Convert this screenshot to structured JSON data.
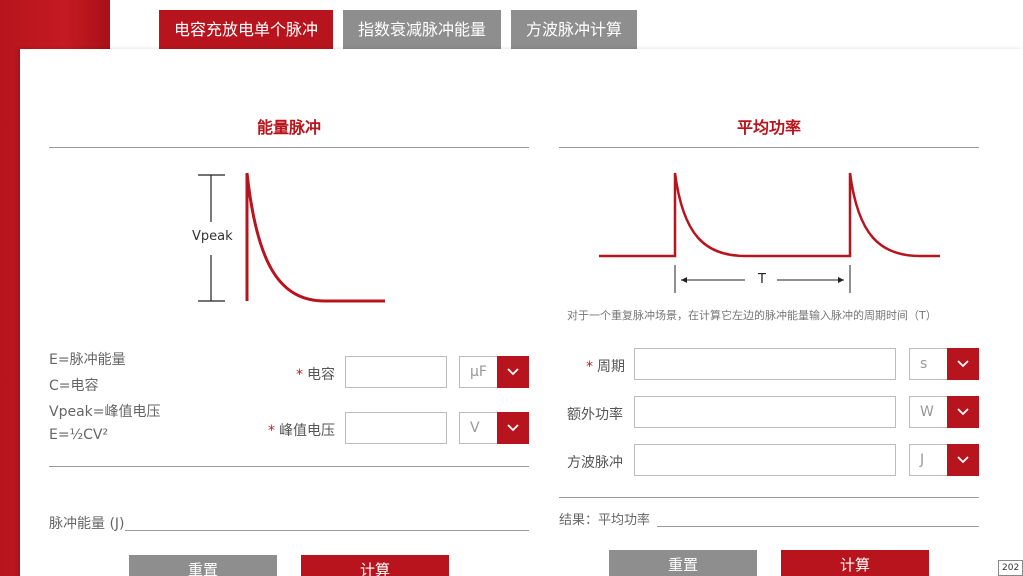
{
  "tabs": [
    {
      "label": "电容充放电单个脉冲",
      "active": true
    },
    {
      "label": "指数衰减脉冲能量",
      "active": false
    },
    {
      "label": "方波脉冲计算",
      "active": false
    }
  ],
  "left": {
    "title": "能量脉冲",
    "diagram_label": "Vpeak",
    "formulas": [
      "E=脉冲能量",
      "C=电容",
      "Vpeak=峰值电压",
      "E=½CV²"
    ],
    "fields": [
      {
        "label": "电容",
        "required": true,
        "value": "",
        "unit": "μF"
      },
      {
        "label": "峰值电压",
        "required": true,
        "value": "",
        "unit": "V"
      }
    ],
    "result_label": "脉冲能量 (J)",
    "reset_label": "重置",
    "calc_label": "计算"
  },
  "right": {
    "title": "平均功率",
    "diagram_label": "T",
    "note": "对于一个重复脉冲场景，在计算它左边的脉冲能量输入脉冲的周期时间（T）",
    "fields": [
      {
        "label": "周期",
        "required": true,
        "value": "",
        "unit": "s"
      },
      {
        "label": "额外功率",
        "required": false,
        "value": "",
        "unit": "W"
      },
      {
        "label": "方波脉冲",
        "required": false,
        "value": "",
        "unit": "J"
      }
    ],
    "result_label": "结果：平均功率",
    "reset_label": "重置",
    "calc_label": "计算"
  },
  "footer": {
    "year_text": "202"
  },
  "colors": {
    "accent": "#b8141d",
    "grey": "#8e8e8e"
  }
}
